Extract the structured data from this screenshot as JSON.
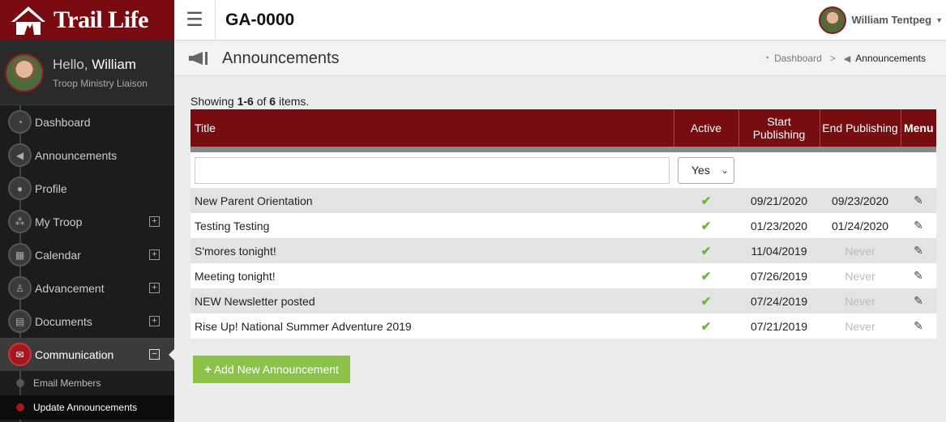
{
  "brand": {
    "name": "Trail Life"
  },
  "user": {
    "greeting": "Hello,",
    "first_name": "William",
    "role": "Troop Ministry Liaison",
    "full_name": "William Tentpeg"
  },
  "topbar": {
    "troop_id": "GA-0000"
  },
  "sidebar": {
    "items": [
      {
        "label": "Dashboard",
        "icon": "dashboard-icon"
      },
      {
        "label": "Announcements",
        "icon": "megaphone-icon"
      },
      {
        "label": "Profile",
        "icon": "user-icon"
      },
      {
        "label": "My Troop",
        "icon": "group-icon",
        "expand": "⊞"
      },
      {
        "label": "Calendar",
        "icon": "calendar-icon",
        "expand": "⊞"
      },
      {
        "label": "Advancement",
        "icon": "hiker-icon",
        "expand": "⊞"
      },
      {
        "label": "Documents",
        "icon": "document-icon",
        "expand": "⊞"
      },
      {
        "label": "Communication",
        "icon": "envelope-icon",
        "expand": "⊟"
      }
    ],
    "subitems": [
      {
        "label": "Email Members"
      },
      {
        "label": "Update Announcements"
      }
    ]
  },
  "page": {
    "title": "Announcements",
    "breadcrumb": {
      "home": "Dashboard",
      "separator": ">",
      "current": "Announcements"
    }
  },
  "table": {
    "summary": {
      "prefix": "Showing ",
      "range": "1-6",
      "of": " of ",
      "total": "6",
      "suffix": " items."
    },
    "columns": {
      "title": "Title",
      "active": "Active",
      "start_line1": "Start",
      "start_line2": "Publishing",
      "end": "End Publishing",
      "menu": "Menu"
    },
    "filter": {
      "title_value": "",
      "active_value": "Yes"
    },
    "rows": [
      {
        "title": "New Parent Orientation",
        "start": "09/21/2020",
        "end": "09/23/2020"
      },
      {
        "title": "Testing Testing",
        "start": "01/23/2020",
        "end": "01/24/2020"
      },
      {
        "title": "S'mores tonight!",
        "start": "11/04/2019",
        "end": "Never"
      },
      {
        "title": "Meeting tonight!",
        "start": "07/26/2019",
        "end": "Never"
      },
      {
        "title": "NEW Newsletter posted",
        "start": "07/24/2019",
        "end": "Never"
      },
      {
        "title": "Rise Up! National Summer Adventure 2019",
        "start": "07/21/2019",
        "end": "Never"
      }
    ]
  },
  "actions": {
    "add_label": "Add New Announcement"
  },
  "colors": {
    "brand": "#7a0a12",
    "header": "#770c11",
    "accent_green": "#8bc34a",
    "check_green": "#6db33f"
  }
}
